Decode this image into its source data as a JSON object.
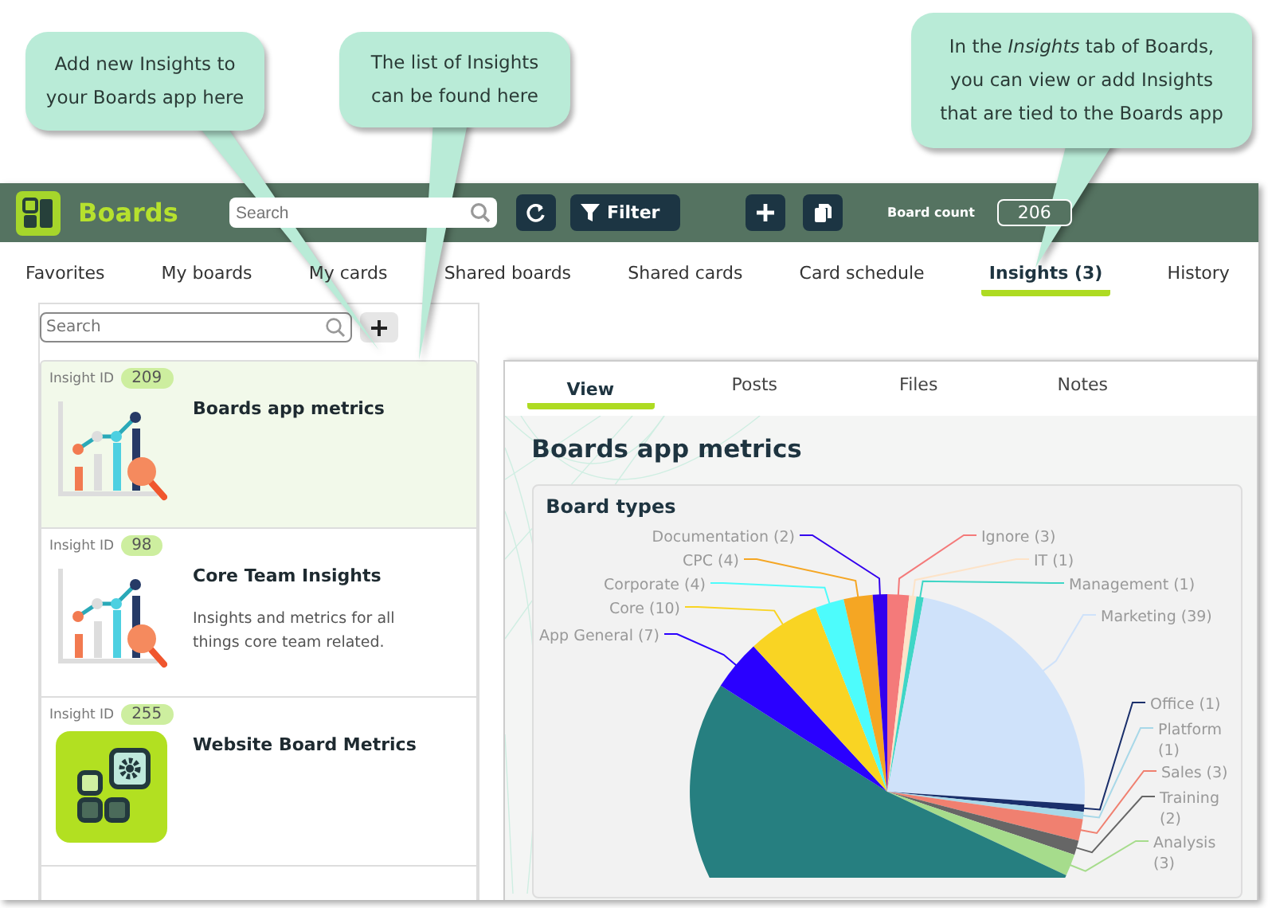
{
  "callouts": [
    {
      "lines": [
        "Add new Insights to",
        "your Boards app here"
      ]
    },
    {
      "lines": [
        "The list of Insights",
        "can be found here"
      ]
    },
    {
      "lines": [
        "In the *Insights* tab of Boards,",
        "you can view or add Insights",
        "that are tied to the Boards app"
      ]
    }
  ],
  "header": {
    "app_name": "Boards",
    "search": {
      "placeholder": "Search"
    },
    "filter_label": "Filter",
    "board_count_label": "Board count",
    "board_count": "206"
  },
  "tabs": [
    {
      "label": "Favorites",
      "selected": false
    },
    {
      "label": "My boards",
      "selected": false
    },
    {
      "label": "My cards",
      "selected": false
    },
    {
      "label": "Shared boards",
      "selected": false
    },
    {
      "label": "Shared cards",
      "selected": false
    },
    {
      "label": "Card schedule",
      "selected": false
    },
    {
      "label": "Insights (3)",
      "selected": true
    },
    {
      "label": "History",
      "selected": false
    }
  ],
  "insights_panel": {
    "search": {
      "placeholder": "Search"
    },
    "items": [
      {
        "kind": "chart",
        "id_label": "Insight ID",
        "id": "209",
        "title": "Boards app metrics",
        "selected": true
      },
      {
        "kind": "chart",
        "id_label": "Insight ID",
        "id": "98",
        "title": "Core Team Insights",
        "description": "Insights and metrics for all things core team related.",
        "selected": false
      },
      {
        "kind": "app",
        "id_label": "Insight ID",
        "id": "255",
        "title": "Website Board Metrics",
        "selected": false
      }
    ]
  },
  "detail": {
    "tabs": [
      {
        "label": "View",
        "selected": true
      },
      {
        "label": "Posts",
        "selected": false
      },
      {
        "label": "Files",
        "selected": false
      },
      {
        "label": "Notes",
        "selected": false
      }
    ],
    "title": "Boards app metrics",
    "card": {
      "chart_data": {
        "type": "pie",
        "title": "Board types",
        "categories": [
          "Ignore (3)",
          "IT (1)",
          "Management (1)",
          "Marketing (39)",
          "Office (1)",
          "Platform (1)",
          "Sales (3)",
          "Training (2)",
          "Analysis (3)",
          null,
          "App General  (7)",
          "Core (10)",
          "Corporate (4)",
          "CPC (4)",
          "Documentation (2)"
        ],
        "values": [
          3,
          1,
          1,
          39,
          1,
          1,
          3,
          2,
          3,
          88,
          7,
          10,
          4,
          4,
          2
        ],
        "colors": [
          "#f47a7a",
          "#fde3c8",
          "#3fd6c6",
          "#cfe2fa",
          "#1a2f6b",
          "#a8d8e8",
          "#f08070",
          "#666666",
          "#a6dc8c",
          "#267f80",
          "#2a00ff",
          "#f9d423",
          "#4dfcfc",
          "#f5a623",
          "#3300ee"
        ]
      }
    }
  }
}
